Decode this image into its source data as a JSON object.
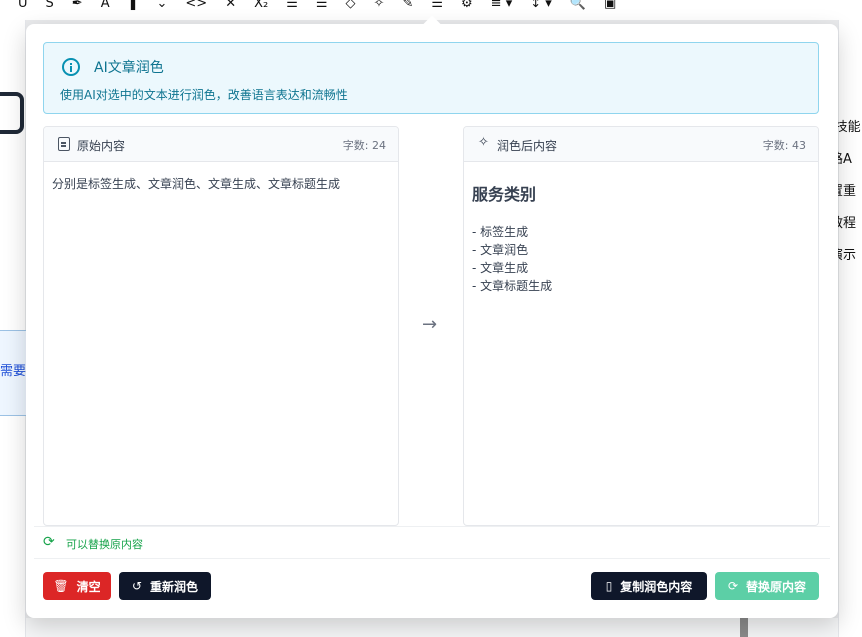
{
  "background": {
    "toolbar_glyphs": [
      "U",
      "S",
      "✒",
      "A",
      "❚",
      "⌄",
      "<>",
      "✕",
      "X₂",
      "☰",
      "☰",
      "◇",
      "✧",
      "✎",
      "☰",
      "⚙",
      "≡ ▾",
      "↕ ▾",
      "🔍",
      "▣"
    ],
    "left_text": "需要",
    "right_texts": [
      "f技能",
      "路A",
      "置重",
      "教程",
      "演示"
    ]
  },
  "dialog": {
    "info": {
      "title": "AI文章润色",
      "description": "使用AI对选中的文本进行润色，改善语言表达和流畅性"
    },
    "original": {
      "title": "原始内容",
      "count": "字数: 24",
      "text": "分别是标签生成、文章润色、文章生成、文章标题生成"
    },
    "polished": {
      "title": "润色后内容",
      "count": "字数: 43",
      "heading": "服务类别",
      "items": [
        "- 标签生成",
        "- 文章润色",
        "- 文章生成",
        "- 文章标题生成"
      ]
    },
    "arrow": "→",
    "status": "可以替换原内容",
    "buttons": {
      "clear": "清空",
      "regenerate": "重新润色",
      "copy": "复制润色内容",
      "replace": "替换原内容"
    }
  }
}
